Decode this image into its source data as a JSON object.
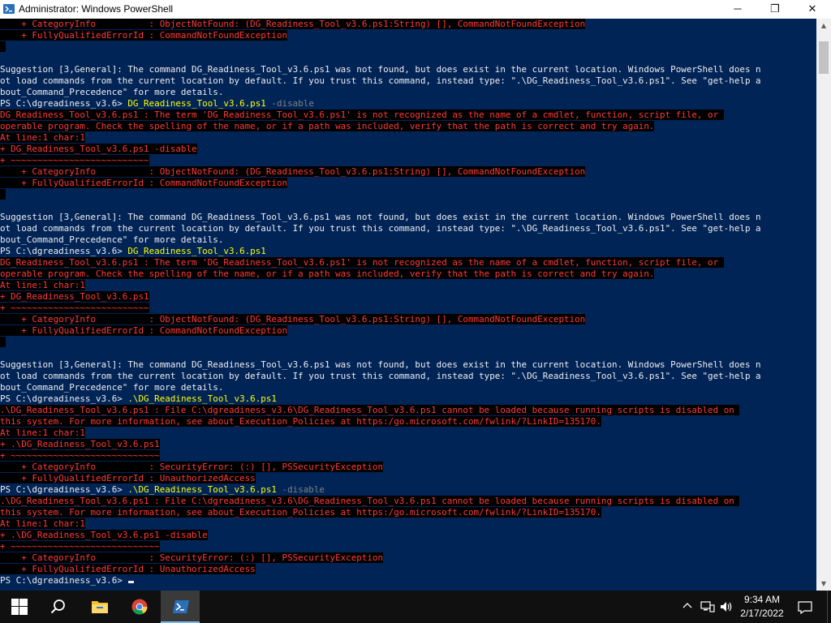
{
  "window": {
    "title": "Administrator: Windows PowerShell",
    "controls": {
      "minimize": "─",
      "maximize": "❐",
      "close": "✕"
    }
  },
  "colors": {
    "console_bg": "#012456",
    "console_fg": "#eeedf0",
    "error_fg": "#ff3a3a",
    "error_bg": "#000000",
    "command": "#ffff00",
    "parameter": "#808080"
  },
  "console": {
    "lines": [
      [
        {
          "t": "    + CategoryInfo          : ObjectNotFound: (DG_Readiness_Tool_v3.6.ps1:String) [], CommandNotFoundException",
          "s": "err"
        }
      ],
      [
        {
          "t": "    + FullyQualifiedErrorId : CommandNotFoundException",
          "s": "err"
        }
      ],
      [
        {
          "t": " ",
          "s": "err"
        }
      ],
      [],
      [
        {
          "t": "Suggestion [3,General]: The command DG_Readiness_Tool_v3.6.ps1 was not found, but does exist in the current location. Windows PowerShell does n",
          "s": "out"
        }
      ],
      [
        {
          "t": "ot load commands from the current location by default. If you trust this command, instead type: \".\\DG_Readiness_Tool_v3.6.ps1\". See \"get-help a",
          "s": "out"
        }
      ],
      [
        {
          "t": "bout_Command_Precedence\" for more details.",
          "s": "out"
        }
      ],
      [
        {
          "t": "PS C:\\dgreadiness_v3.6> ",
          "s": "out"
        },
        {
          "t": "DG_Readiness_Tool_v3.6.ps1",
          "s": "cmd"
        },
        {
          "t": " -disable",
          "s": "param"
        }
      ],
      [
        {
          "t": "DG_Readiness_Tool_v3.6.ps1 : The term 'DG_Readiness_Tool_v3.6.ps1' is not recognized as the name of a cmdlet, function, script file, or ",
          "s": "err"
        }
      ],
      [
        {
          "t": "operable program. Check the spelling of the name, or if a path was included, verify that the path is correct and try again.",
          "s": "err"
        }
      ],
      [
        {
          "t": "At line:1 char:1",
          "s": "err"
        }
      ],
      [
        {
          "t": "+ DG_Readiness_Tool_v3.6.ps1 -disable",
          "s": "err"
        }
      ],
      [
        {
          "t": "+ ~~~~~~~~~~~~~~~~~~~~~~~~~~",
          "s": "err"
        }
      ],
      [
        {
          "t": "    + CategoryInfo          : ObjectNotFound: (DG_Readiness_Tool_v3.6.ps1:String) [], CommandNotFoundException",
          "s": "err"
        }
      ],
      [
        {
          "t": "    + FullyQualifiedErrorId : CommandNotFoundException",
          "s": "err"
        }
      ],
      [
        {
          "t": " ",
          "s": "err"
        }
      ],
      [],
      [
        {
          "t": "Suggestion [3,General]: The command DG_Readiness_Tool_v3.6.ps1 was not found, but does exist in the current location. Windows PowerShell does n",
          "s": "out"
        }
      ],
      [
        {
          "t": "ot load commands from the current location by default. If you trust this command, instead type: \".\\DG_Readiness_Tool_v3.6.ps1\". See \"get-help a",
          "s": "out"
        }
      ],
      [
        {
          "t": "bout_Command_Precedence\" for more details.",
          "s": "out"
        }
      ],
      [
        {
          "t": "PS C:\\dgreadiness_v3.6> ",
          "s": "out"
        },
        {
          "t": "DG_Readiness_Tool_v3.6.ps1",
          "s": "cmd"
        }
      ],
      [
        {
          "t": "DG_Readiness_Tool_v3.6.ps1 : The term 'DG_Readiness_Tool_v3.6.ps1' is not recognized as the name of a cmdlet, function, script file, or ",
          "s": "err"
        }
      ],
      [
        {
          "t": "operable program. Check the spelling of the name, or if a path was included, verify that the path is correct and try again.",
          "s": "err"
        }
      ],
      [
        {
          "t": "At line:1 char:1",
          "s": "err"
        }
      ],
      [
        {
          "t": "+ DG_Readiness_Tool_v3.6.ps1",
          "s": "err"
        }
      ],
      [
        {
          "t": "+ ~~~~~~~~~~~~~~~~~~~~~~~~~~",
          "s": "err"
        }
      ],
      [
        {
          "t": "    + CategoryInfo          : ObjectNotFound: (DG_Readiness_Tool_v3.6.ps1:String) [], CommandNotFoundException",
          "s": "err"
        }
      ],
      [
        {
          "t": "    + FullyQualifiedErrorId : CommandNotFoundException",
          "s": "err"
        }
      ],
      [
        {
          "t": " ",
          "s": "err"
        }
      ],
      [],
      [
        {
          "t": "Suggestion [3,General]: The command DG_Readiness_Tool_v3.6.ps1 was not found, but does exist in the current location. Windows PowerShell does n",
          "s": "out"
        }
      ],
      [
        {
          "t": "ot load commands from the current location by default. If you trust this command, instead type: \".\\DG_Readiness_Tool_v3.6.ps1\". See \"get-help a",
          "s": "out"
        }
      ],
      [
        {
          "t": "bout_Command_Precedence\" for more details.",
          "s": "out"
        }
      ],
      [
        {
          "t": "PS C:\\dgreadiness_v3.6> ",
          "s": "out"
        },
        {
          "t": ".\\DG_Readiness_Tool_v3.6.ps1",
          "s": "cmd"
        }
      ],
      [
        {
          "t": ".\\DG_Readiness_Tool_v3.6.ps1 : File C:\\dgreadiness_v3.6\\DG_Readiness_Tool_v3.6.ps1 cannot be loaded because running scripts is disabled on ",
          "s": "err"
        }
      ],
      [
        {
          "t": "this system. For more information, see about_Execution_Policies at https:/go.microsoft.com/fwlink/?LinkID=135170.",
          "s": "err"
        }
      ],
      [
        {
          "t": "At line:1 char:1",
          "s": "err"
        }
      ],
      [
        {
          "t": "+ .\\DG_Readiness_Tool_v3.6.ps1",
          "s": "err"
        }
      ],
      [
        {
          "t": "+ ~~~~~~~~~~~~~~~~~~~~~~~~~~~~",
          "s": "err"
        }
      ],
      [
        {
          "t": "    + CategoryInfo          : SecurityError: (:) [], PSSecurityException",
          "s": "err"
        }
      ],
      [
        {
          "t": "    + FullyQualifiedErrorId : UnauthorizedAccess",
          "s": "err"
        }
      ],
      [
        {
          "t": "PS C:\\dgreadiness_v3.6> ",
          "s": "out"
        },
        {
          "t": ".\\DG_Readiness_Tool_v3.6.ps1",
          "s": "cmd"
        },
        {
          "t": " -disable",
          "s": "param"
        }
      ],
      [
        {
          "t": ".\\DG_Readiness_Tool_v3.6.ps1 : File C:\\dgreadiness_v3.6\\DG_Readiness_Tool_v3.6.ps1 cannot be loaded because running scripts is disabled on ",
          "s": "err"
        }
      ],
      [
        {
          "t": "this system. For more information, see about_Execution_Policies at https:/go.microsoft.com/fwlink/?LinkID=135170.",
          "s": "err"
        }
      ],
      [
        {
          "t": "At line:1 char:1",
          "s": "err"
        }
      ],
      [
        {
          "t": "+ .\\DG_Readiness_Tool_v3.6.ps1 -disable",
          "s": "err"
        }
      ],
      [
        {
          "t": "+ ~~~~~~~~~~~~~~~~~~~~~~~~~~~~",
          "s": "err"
        }
      ],
      [
        {
          "t": "    + CategoryInfo          : SecurityError: (:) [], PSSecurityException",
          "s": "err"
        }
      ],
      [
        {
          "t": "    + FullyQualifiedErrorId : UnauthorizedAccess",
          "s": "err"
        }
      ],
      [
        {
          "t": "PS C:\\dgreadiness_v3.6> ",
          "s": "out"
        }
      ]
    ]
  },
  "taskbar": {
    "apps": [
      {
        "name": "start",
        "icon": "windows-logo-icon"
      },
      {
        "name": "search",
        "icon": "search-icon"
      },
      {
        "name": "file-explorer",
        "icon": "folder-icon"
      },
      {
        "name": "chrome",
        "icon": "chrome-icon"
      },
      {
        "name": "powershell",
        "icon": "powershell-icon",
        "active": true
      }
    ],
    "tray": {
      "chevron": "^",
      "time": "9:34 AM",
      "date": "2/17/2022"
    }
  }
}
